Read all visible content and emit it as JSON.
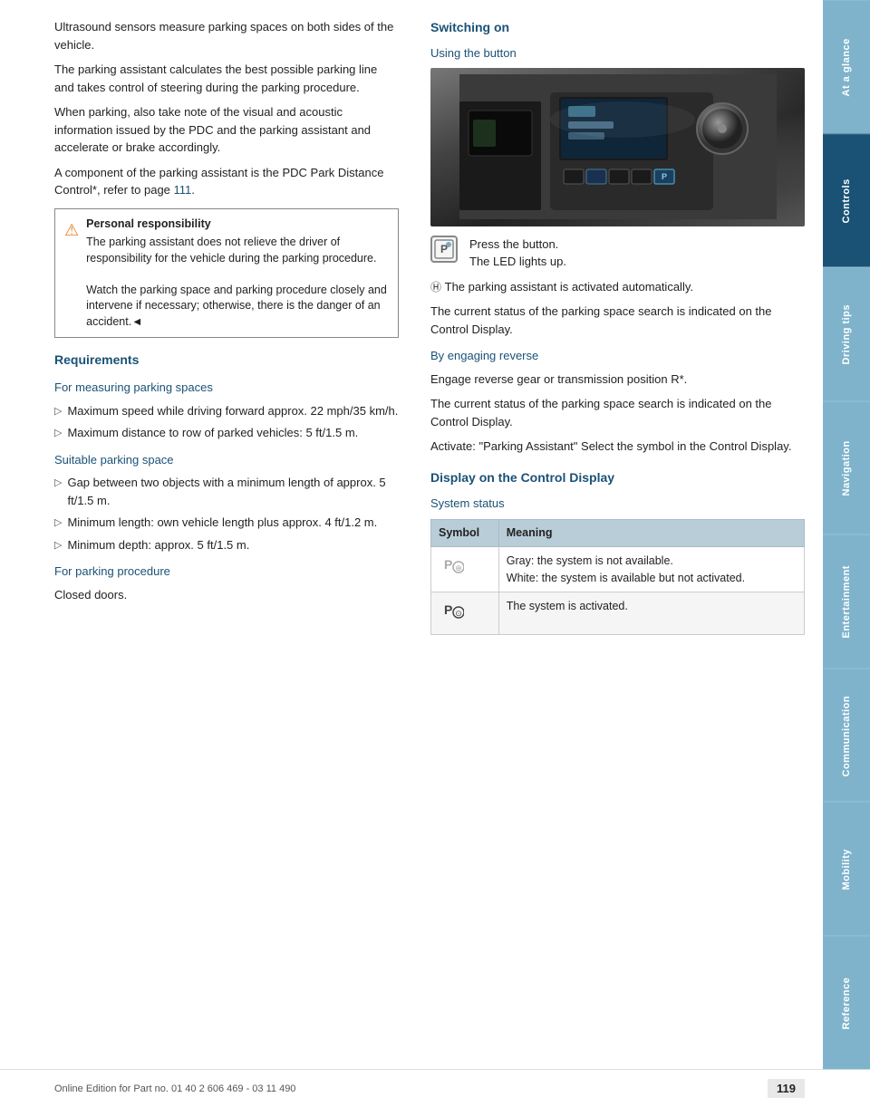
{
  "sidebar": {
    "tabs": [
      {
        "label": "At a glance",
        "active": false
      },
      {
        "label": "Controls",
        "active": true
      },
      {
        "label": "Driving tips",
        "active": false
      },
      {
        "label": "Navigation",
        "active": false
      },
      {
        "label": "Entertainment",
        "active": false
      },
      {
        "label": "Communication",
        "active": false
      },
      {
        "label": "Mobility",
        "active": false
      },
      {
        "label": "Reference",
        "active": false
      }
    ]
  },
  "left_col": {
    "intro_paragraphs": [
      "Ultrasound sensors measure parking spaces on both sides of the vehicle.",
      "The parking assistant calculates the best possible parking line and takes control of steering during the parking procedure.",
      "When parking, also take note of the visual and acoustic information issued by the PDC and the parking assistant and accelerate or brake accordingly.",
      "A component of the parking assistant is the PDC Park Distance Control*, refer to page 111."
    ],
    "page_ref": "111",
    "warning": {
      "title": "Personal responsibility",
      "text": "The parking assistant does not relieve the driver of responsibility for the vehicle during the parking procedure.",
      "text2": "Watch the parking space and parking procedure closely and intervene if necessary; otherwise, there is the danger of an accident.◄"
    },
    "requirements_heading": "Requirements",
    "measuring_heading": "For measuring parking spaces",
    "measuring_items": [
      "Maximum speed while driving forward approx. 22 mph/35 km/h.",
      "Maximum distance to row of parked vehicles: 5 ft/1.5 m."
    ],
    "suitable_heading": "Suitable parking space",
    "suitable_items": [
      "Gap between two objects with a minimum length of approx. 5 ft/1.5 m.",
      "Minimum length: own vehicle length plus approx. 4 ft/1.2 m.",
      "Minimum depth: approx. 5 ft/1.5 m."
    ],
    "parking_procedure_heading": "For parking procedure",
    "parking_procedure_text": "Closed doors."
  },
  "right_col": {
    "switching_on_heading": "Switching on",
    "using_button_heading": "Using the button",
    "press_text": "Press the button.",
    "led_text": "The LED lights up.",
    "auto_activate_text": "The parking assistant is activated automatically.",
    "status_text": "The current status of the parking space search is indicated on the Control Display.",
    "engaging_reverse_heading": "By engaging reverse",
    "engage_text": "Engage reverse gear or transmission position R*.",
    "engage_status_text": "The current status of the parking space search is indicated on the Control Display.",
    "activate_text": "Activate:  \"Parking Assistant\" Select the symbol in the Control Display.",
    "display_heading": "Display on the Control Display",
    "system_status_heading": "System status",
    "table": {
      "headers": [
        "Symbol",
        "Meaning"
      ],
      "rows": [
        {
          "symbol": "P⊕",
          "meaning_lines": [
            "Gray: the system is not available.",
            "White: the system is available but not activated."
          ]
        },
        {
          "symbol": "P⊙",
          "meaning_lines": [
            "The system is activated."
          ]
        }
      ]
    }
  },
  "footer": {
    "left_text": "Online Edition for Part no. 01 40 2 606 469 - 03 11 490",
    "page_number": "119"
  }
}
